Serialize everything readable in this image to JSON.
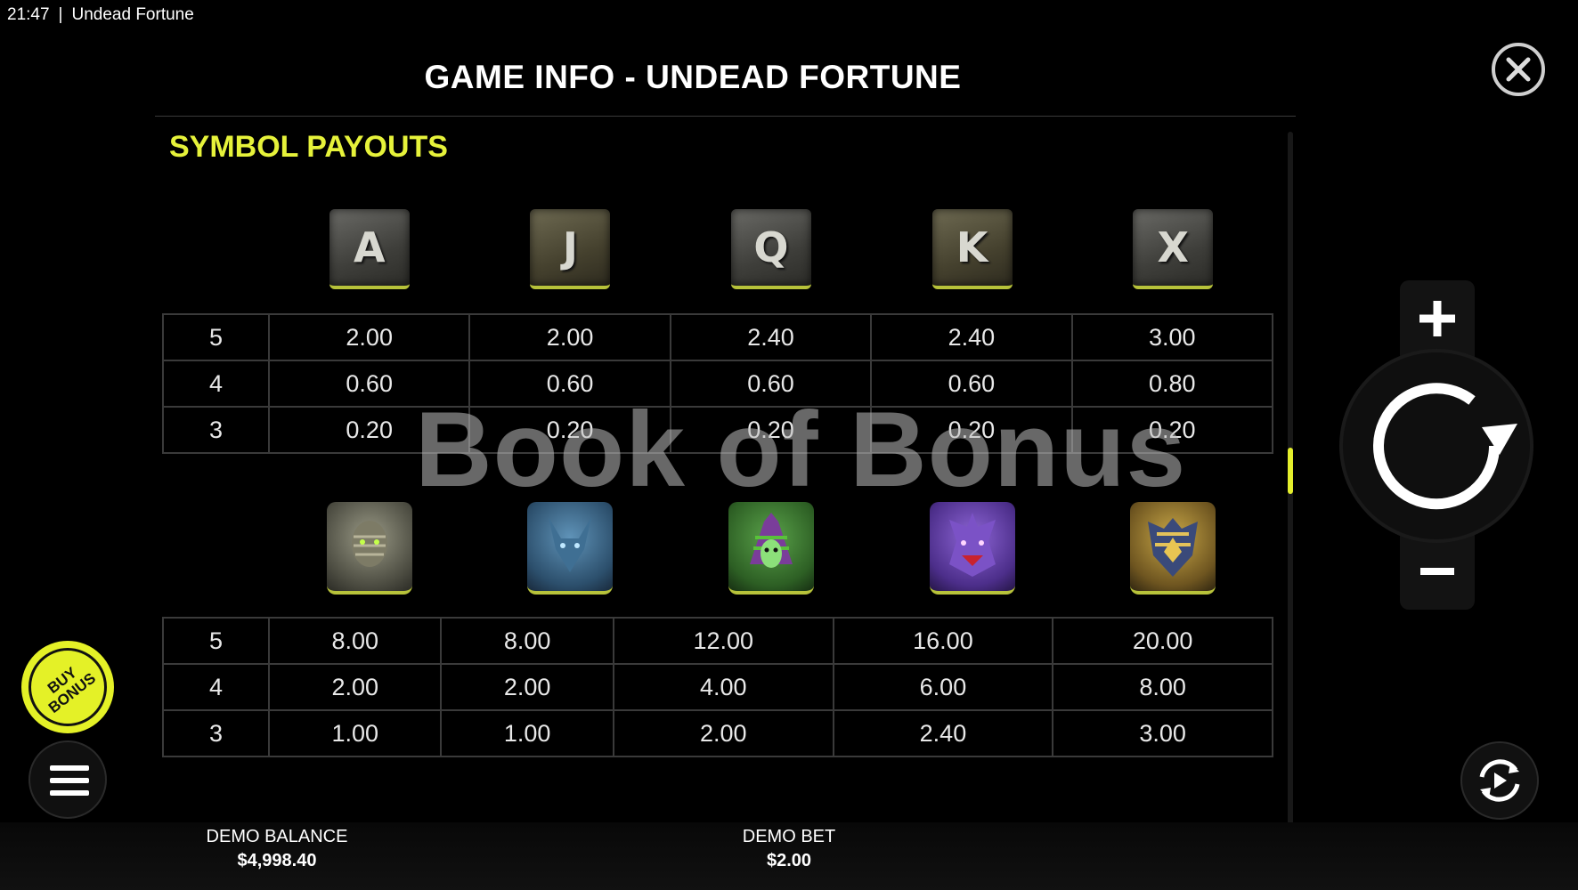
{
  "status_bar": {
    "time": "21:47",
    "separator": "|",
    "app_name": "Undead Fortune"
  },
  "header": {
    "title": "GAME INFO - UNDEAD FORTUNE"
  },
  "section": {
    "title": "SYMBOL PAYOUTS"
  },
  "watermark": "Book of Bonus",
  "low_symbols": [
    {
      "name": "ace-symbol-icon",
      "glyph": "A",
      "tone": "grey"
    },
    {
      "name": "jack-symbol-icon",
      "glyph": "J",
      "tone": "tan"
    },
    {
      "name": "queen-symbol-icon",
      "glyph": "Q",
      "tone": "grey"
    },
    {
      "name": "king-symbol-icon",
      "glyph": "K",
      "tone": "tan"
    },
    {
      "name": "ten-symbol-icon",
      "glyph": "X",
      "tone": "grey"
    }
  ],
  "low_table": [
    {
      "count": "5",
      "values": [
        "2.00",
        "2.00",
        "2.40",
        "2.40",
        "3.00"
      ]
    },
    {
      "count": "4",
      "values": [
        "0.60",
        "0.60",
        "0.60",
        "0.60",
        "0.80"
      ]
    },
    {
      "count": "3",
      "values": [
        "0.20",
        "0.20",
        "0.20",
        "0.20",
        "0.20"
      ]
    }
  ],
  "high_symbols": [
    {
      "name": "mummy-symbol-icon",
      "color": "#6b6b5e"
    },
    {
      "name": "blue-jackal-symbol-icon",
      "color": "#3e6d8f"
    },
    {
      "name": "green-pharaoh-symbol-icon",
      "color": "#3f7a34"
    },
    {
      "name": "purple-beast-symbol-icon",
      "color": "#6b45a8"
    },
    {
      "name": "golden-falcon-symbol-icon",
      "color": "#9a7a2c"
    }
  ],
  "high_table": [
    {
      "count": "5",
      "values": [
        "8.00",
        "8.00",
        "12.00",
        "16.00",
        "20.00"
      ]
    },
    {
      "count": "4",
      "values": [
        "2.00",
        "2.00",
        "4.00",
        "6.00",
        "8.00"
      ]
    },
    {
      "count": "3",
      "values": [
        "1.00",
        "1.00",
        "2.00",
        "2.40",
        "3.00"
      ]
    }
  ],
  "buy_bonus": {
    "label_line1": "BUY",
    "label_line2": "BONUS"
  },
  "footer": {
    "balance_label": "DEMO BALANCE",
    "balance_value": "$4,998.40",
    "bet_label": "DEMO BET",
    "bet_value": "$2.00"
  },
  "colors": {
    "accent": "#e4f127",
    "background": "#000000"
  }
}
